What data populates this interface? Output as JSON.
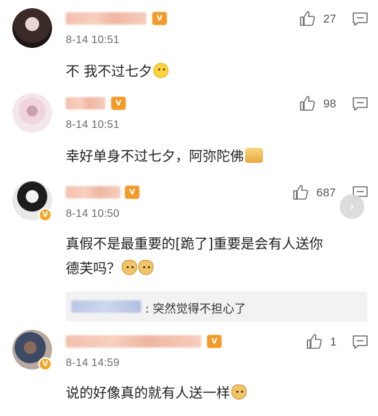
{
  "comments": [
    {
      "time": "8-14 10:51",
      "likes": "27",
      "text": "不 我不过七夕",
      "emoji": "thinking-face-icon",
      "level_badge": "V"
    },
    {
      "time": "8-14 10:51",
      "likes": "98",
      "text": "幸好单身不过七夕，阿弥陀佛",
      "emoji": "praying-hands-icon",
      "level_badge": "V"
    },
    {
      "time": "8-14 10:50",
      "likes": "687",
      "text_line1": "真假不是最重要的[跪了]重要是会有人送你",
      "text_line2": "德芙吗？",
      "emoji": "doge-icon",
      "level_badge": "V",
      "reply": {
        "text": ": 突然觉得不担心了"
      }
    },
    {
      "time": "8-14 14:59",
      "likes": "1",
      "text": "说的好像真的就有人送一样",
      "emoji": "doge-icon",
      "level_badge": "V"
    }
  ],
  "colors": {
    "accent_orange": "#f29b2b",
    "text_primary": "#222222",
    "text_secondary": "#6b6b6b"
  }
}
